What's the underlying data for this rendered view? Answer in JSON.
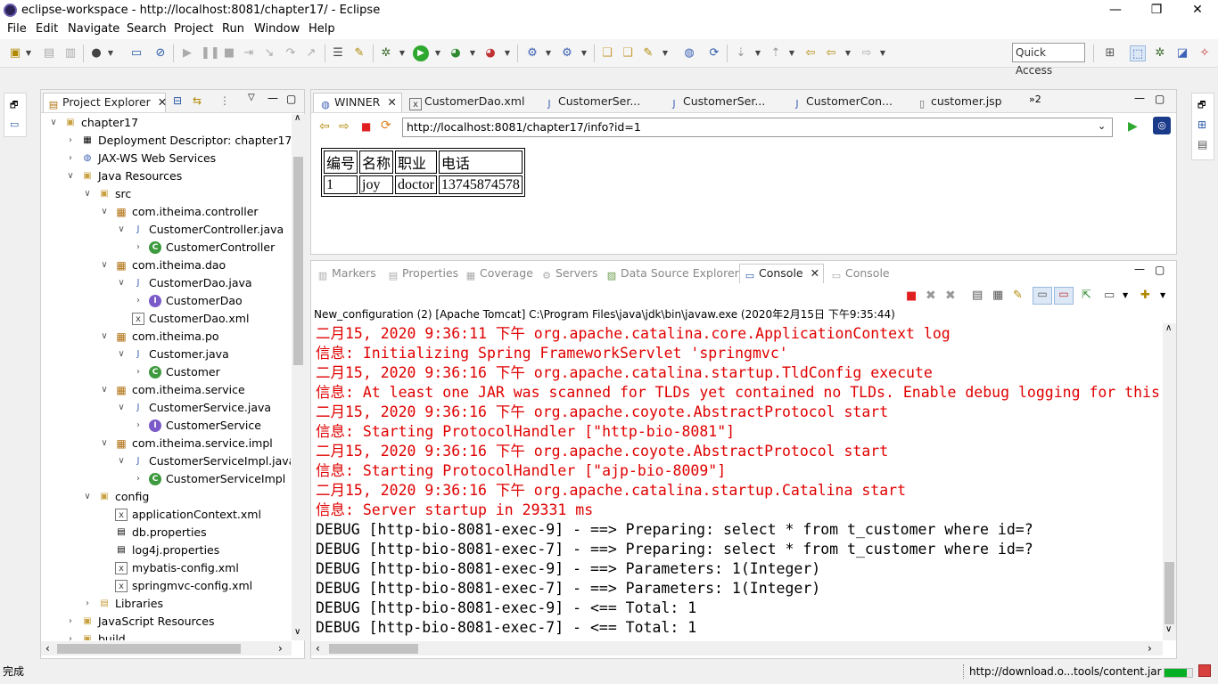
{
  "window": {
    "title": "eclipse-workspace - http://localhost:8081/chapter17/ - Eclipse",
    "minimize": "—",
    "maximize": "❐",
    "close": "✕"
  },
  "menu": [
    "File",
    "Edit",
    "Navigate",
    "Search",
    "Project",
    "Run",
    "Window",
    "Help"
  ],
  "quick_access": "Quick Access",
  "project_explorer": {
    "tab_label": "Project Explorer",
    "tree": [
      {
        "label": "chapter17",
        "icon": "project-icon",
        "twisty": "∨"
      },
      {
        "label": "Deployment Descriptor: chapter17",
        "icon": "deployment-icon",
        "twisty": "›"
      },
      {
        "label": "JAX-WS Web Services",
        "icon": "webservice-icon",
        "twisty": "›"
      },
      {
        "label": "Java Resources",
        "icon": "java-resources-icon",
        "twisty": "∨"
      },
      {
        "label": "src",
        "icon": "source-folder-icon",
        "twisty": "∨"
      },
      {
        "label": "com.itheima.controller",
        "icon": "package-icon",
        "twisty": "∨"
      },
      {
        "label": "CustomerController.java",
        "icon": "java-file-icon",
        "twisty": "∨"
      },
      {
        "label": "CustomerController",
        "icon": "class-icon",
        "twisty": "›"
      },
      {
        "label": "com.itheima.dao",
        "icon": "package-icon",
        "twisty": "∨"
      },
      {
        "label": "CustomerDao.java",
        "icon": "java-file-icon",
        "twisty": "∨"
      },
      {
        "label": "CustomerDao",
        "icon": "interface-icon",
        "twisty": "›"
      },
      {
        "label": "CustomerDao.xml",
        "icon": "xml-file-icon",
        "twisty": ""
      },
      {
        "label": "com.itheima.po",
        "icon": "package-icon",
        "twisty": "∨"
      },
      {
        "label": "Customer.java",
        "icon": "java-file-icon",
        "twisty": "∨"
      },
      {
        "label": "Customer",
        "icon": "class-icon",
        "twisty": "›"
      },
      {
        "label": "com.itheima.service",
        "icon": "package-icon",
        "twisty": "∨"
      },
      {
        "label": "CustomerService.java",
        "icon": "java-file-icon",
        "twisty": "∨"
      },
      {
        "label": "CustomerService",
        "icon": "interface-icon",
        "twisty": "›"
      },
      {
        "label": "com.itheima.service.impl",
        "icon": "package-icon",
        "twisty": "∨"
      },
      {
        "label": "CustomerServiceImpl.java",
        "icon": "java-file-icon",
        "twisty": "∨"
      },
      {
        "label": "CustomerServiceImpl",
        "icon": "class-icon",
        "twisty": "›"
      },
      {
        "label": "config",
        "icon": "source-folder-icon",
        "twisty": "∨"
      },
      {
        "label": "applicationContext.xml",
        "icon": "xml-file-icon",
        "twisty": ""
      },
      {
        "label": "db.properties",
        "icon": "properties-file-icon",
        "twisty": ""
      },
      {
        "label": "log4j.properties",
        "icon": "properties-file-icon",
        "twisty": ""
      },
      {
        "label": "mybatis-config.xml",
        "icon": "xml-file-icon",
        "twisty": ""
      },
      {
        "label": "springmvc-config.xml",
        "icon": "xml-file-icon",
        "twisty": ""
      },
      {
        "label": "Libraries",
        "icon": "libraries-icon",
        "twisty": "›"
      },
      {
        "label": "JavaScript Resources",
        "icon": "javascript-resources-icon",
        "twisty": "›"
      },
      {
        "label": "build",
        "icon": "folder-icon",
        "twisty": "›"
      }
    ]
  },
  "editor": {
    "tabs": [
      "WINNER",
      "CustomerDao.xml",
      "CustomerSer...",
      "CustomerSer...",
      "CustomerCon...",
      "customer.jsp"
    ],
    "overflow": "»2",
    "url": "http://localhost:8081/chapter17/info?id=1",
    "table": {
      "headers": [
        "编号",
        "名称",
        "职业",
        "电话"
      ],
      "rows": [
        [
          "1",
          "joy",
          "doctor",
          "13745874578"
        ]
      ]
    }
  },
  "bottom": {
    "tabs": [
      "Markers",
      "Properties",
      "Coverage",
      "Servers",
      "Data Source Explorer",
      "Console",
      "Console"
    ],
    "launch": "New_configuration (2) [Apache Tomcat] C:\\Program Files\\java\\jdk\\bin\\javaw.exe (2020年2月15日 下午9:35:44)",
    "lines": [
      {
        "text": "二月15, 2020 9:36:11 下午 org.apache.catalina.core.ApplicationContext log",
        "color": "#e00000"
      },
      {
        "text": "信息: Initializing Spring FrameworkServlet 'springmvc'",
        "color": "#e00000"
      },
      {
        "text": "二月15, 2020 9:36:16 下午 org.apache.catalina.startup.TldConfig execute",
        "color": "#e00000"
      },
      {
        "text": "信息: At least one JAR was scanned for TLDs yet contained no TLDs. Enable debug logging for this",
        "color": "#e00000"
      },
      {
        "text": "二月15, 2020 9:36:16 下午 org.apache.coyote.AbstractProtocol start",
        "color": "#e00000"
      },
      {
        "text": "信息: Starting ProtocolHandler [\"http-bio-8081\"]",
        "color": "#e00000"
      },
      {
        "text": "二月15, 2020 9:36:16 下午 org.apache.coyote.AbstractProtocol start",
        "color": "#e00000"
      },
      {
        "text": "信息: Starting ProtocolHandler [\"ajp-bio-8009\"]",
        "color": "#e00000"
      },
      {
        "text": "二月15, 2020 9:36:16 下午 org.apache.catalina.startup.Catalina start",
        "color": "#e00000"
      },
      {
        "text": "信息: Server startup in 29331 ms",
        "color": "#e00000"
      },
      {
        "text": "DEBUG [http-bio-8081-exec-9] - ==>  Preparing: select * from t_customer where id=?",
        "color": "#000000"
      },
      {
        "text": "DEBUG [http-bio-8081-exec-7] - ==>  Preparing: select * from t_customer where id=?",
        "color": "#000000"
      },
      {
        "text": "DEBUG [http-bio-8081-exec-9] - ==> Parameters: 1(Integer)",
        "color": "#000000"
      },
      {
        "text": "DEBUG [http-bio-8081-exec-7] - ==> Parameters: 1(Integer)",
        "color": "#000000"
      },
      {
        "text": "DEBUG [http-bio-8081-exec-9] - <==      Total: 1",
        "color": "#000000"
      },
      {
        "text": "DEBUG [http-bio-8081-exec-7] - <==      Total: 1",
        "color": "#000000"
      }
    ]
  },
  "status": {
    "left": "完成",
    "right": "http://download.o...tools/content.jar",
    "progress_fraction": 0.8,
    "progress_color": "#06b025"
  }
}
